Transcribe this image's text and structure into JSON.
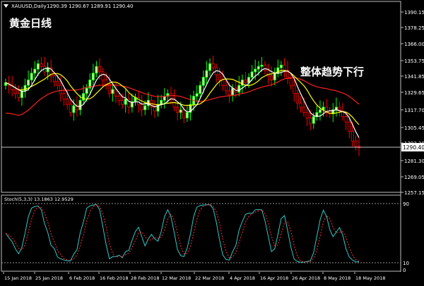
{
  "header": {
    "symbol": "XAUUSD,Daily",
    "ohlc": "1290.39 1290.67 1289.91 1290.40",
    "icon": "chart-menu-icon"
  },
  "annotations": {
    "title_cn": "黄金日线",
    "trend_cn": "整体趋势下行"
  },
  "price_axis": {
    "labels": [
      "1390.15",
      "1378.25",
      "1366.00",
      "1353.75",
      "1341.85",
      "1329.65",
      "1317.70",
      "1305.45",
      "1293.20",
      "1281.30",
      "1269.05",
      "1257.15"
    ],
    "current_price": "1290.40"
  },
  "stoch": {
    "label": "Stoch(5,3,3) 13.1863 12.9529",
    "levels": [
      "90",
      "10",
      "0"
    ]
  },
  "time_axis": {
    "labels": [
      "15 Jan 2018",
      "25 Jan 2018",
      "6 Feb 2018",
      "16 Feb 2018",
      "28 Feb 2018",
      "12 Mar 2018",
      "22 Mar 2018",
      "4 Apr 2018",
      "16 Apr 2018",
      "26 Apr 2018",
      "8 May 2018",
      "18 May 2018"
    ]
  },
  "colors": {
    "up": "#00ff00",
    "down": "#ff0000",
    "up_fill": "#c9f5a0",
    "ma_fast": "#ffffff",
    "ma_mid": "#ffff00",
    "ma_slow": "#ff2020",
    "stoch_main": "#30c8c8",
    "stoch_signal": "#ff3030",
    "frame": "#c0c0c0"
  },
  "chart_data": {
    "type": "line",
    "series": []
  }
}
